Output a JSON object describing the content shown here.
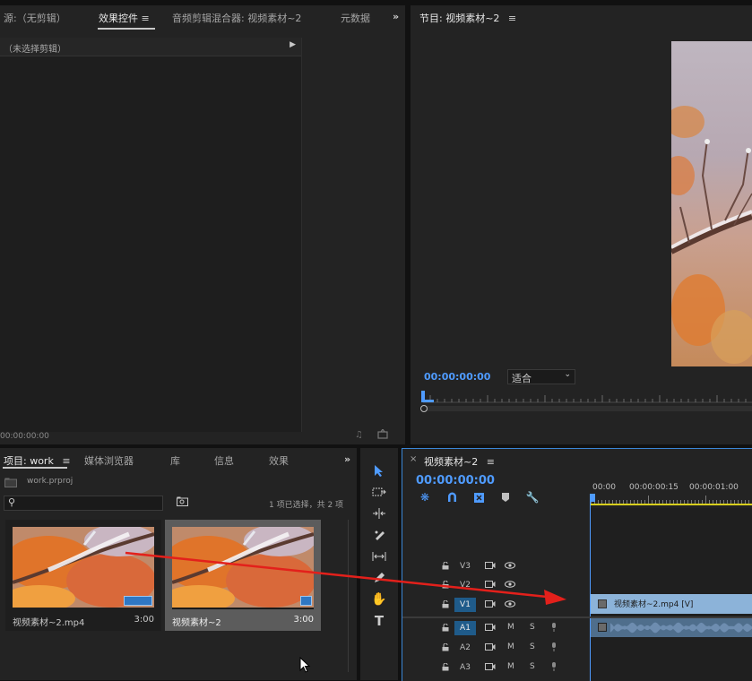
{
  "source_panel": {
    "tabs": [
      "源:（无剪辑）",
      "效果控件",
      "音频剪辑混合器: 视频素材~2",
      "元数据"
    ],
    "active_tab": "效果控件",
    "no_clip_label": "（未选择剪辑）",
    "timecode": "00:00:00:00"
  },
  "program_panel": {
    "title": "节目: 视频素材~2",
    "timecode": "00:00:00:00",
    "fit_option": "适合"
  },
  "project_panel": {
    "tabs": [
      "项目: work",
      "媒体浏览器",
      "库",
      "信息",
      "效果"
    ],
    "active_tab": "项目: work",
    "project_file": "work.prproj",
    "selection_status": "1 项已选择，共 2 项",
    "items": [
      {
        "name": "视频素材~2.mp4",
        "duration": "3:00"
      },
      {
        "name": "视频素材~2",
        "duration": "3:00"
      }
    ]
  },
  "timeline_panel": {
    "title": "视频素材~2",
    "timecode": "00:00:00:00",
    "ruler": [
      "00:00",
      "00:00:00:15",
      "00:00:01:00"
    ],
    "tracks": {
      "video": [
        "V3",
        "V2",
        "V1"
      ],
      "audio": [
        "A1",
        "A2",
        "A3"
      ],
      "mute": "M",
      "solo": "S"
    },
    "clip_label": "视频素材~2.mp4 [V]"
  },
  "colors": {
    "timecode_blue": "#4f9bff",
    "video_clip": "#8cb3d9",
    "audio_clip": "#4f6e8c",
    "arrow_red": "#e3201b",
    "track_target": "#1f5b8a"
  }
}
